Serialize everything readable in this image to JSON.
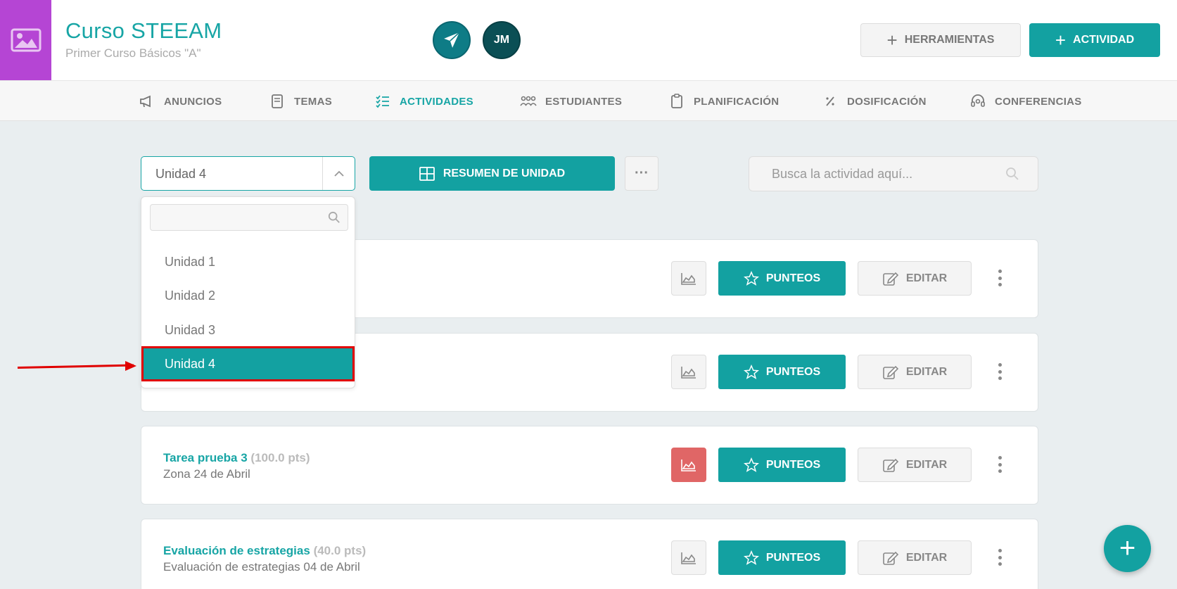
{
  "header": {
    "course_title": "Curso STEEAM",
    "course_subtitle": "Primer Curso Básicos \"A\"",
    "avatar_initials": "JM",
    "tools_label": "HERRAMIENTAS",
    "activity_label": "ACTIVIDAD",
    "thumb_color": "#b545d4"
  },
  "nav": {
    "items": [
      {
        "label": "ANUNCIOS",
        "icon": "megaphone-icon"
      },
      {
        "label": "TEMAS",
        "icon": "book-icon"
      },
      {
        "label": "ACTIVIDADES",
        "icon": "checklist-icon",
        "active": true
      },
      {
        "label": "ESTUDIANTES",
        "icon": "students-icon"
      },
      {
        "label": "PLANIFICACIÓN",
        "icon": "clipboard-icon"
      },
      {
        "label": "DOSIFICACIÓN",
        "icon": "percent-icon"
      },
      {
        "label": "CONFERENCIAS",
        "icon": "headset-icon"
      }
    ]
  },
  "toolbar": {
    "unit_selected": "Unidad 4",
    "summary_label": "RESUMEN DE UNIDAD",
    "more_label": "···",
    "search_placeholder": "Busca la actividad aquí..."
  },
  "dropdown": {
    "search_value": "",
    "options": [
      "Unidad 1",
      "Unidad 2",
      "Unidad 3",
      "Unidad 4"
    ],
    "selected": "Unidad 4"
  },
  "activities": [
    {
      "title": "",
      "points": "",
      "subtitle": "",
      "chart_alert": false
    },
    {
      "title": "",
      "points": "",
      "subtitle": "",
      "chart_alert": false
    },
    {
      "title": "Tarea prueba 3",
      "points": "(100.0 pts)",
      "subtitle": "Zona 24 de Abril",
      "chart_alert": true
    },
    {
      "title": "Evaluación de estrategias",
      "points": "(40.0 pts)",
      "subtitle": "Evaluación de estrategias 04 de Abril",
      "chart_alert": false
    }
  ],
  "buttons": {
    "punteos_label": "PUNTEOS",
    "editar_label": "EDITAR"
  },
  "fab_label": "+",
  "colors": {
    "accent": "#13a1a1",
    "alert": "#e06666",
    "annotation": "#e00000"
  }
}
